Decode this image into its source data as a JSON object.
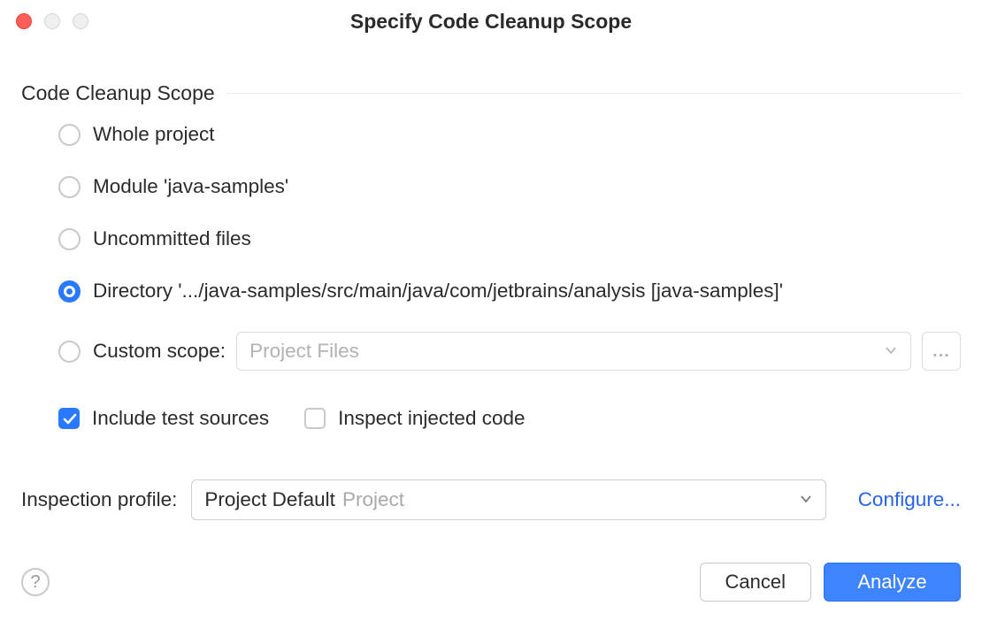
{
  "titlebar": {
    "title": "Specify Code Cleanup Scope"
  },
  "fieldset": {
    "title": "Code Cleanup Scope"
  },
  "scope_options": {
    "whole_project": "Whole project",
    "module": "Module 'java-samples'",
    "uncommitted": "Uncommitted files",
    "directory": "Directory '.../java-samples/src/main/java/com/jetbrains/analysis [java-samples]'",
    "custom_scope_label": "Custom scope:",
    "custom_scope_value": "Project Files",
    "dots": "..."
  },
  "checkboxes": {
    "include_test_sources": "Include test sources",
    "inspect_injected": "Inspect injected code"
  },
  "profile": {
    "label": "Inspection profile:",
    "value": "Project Default",
    "sub": "Project",
    "configure": "Configure..."
  },
  "footer": {
    "help": "?",
    "cancel": "Cancel",
    "analyze": "Analyze"
  }
}
